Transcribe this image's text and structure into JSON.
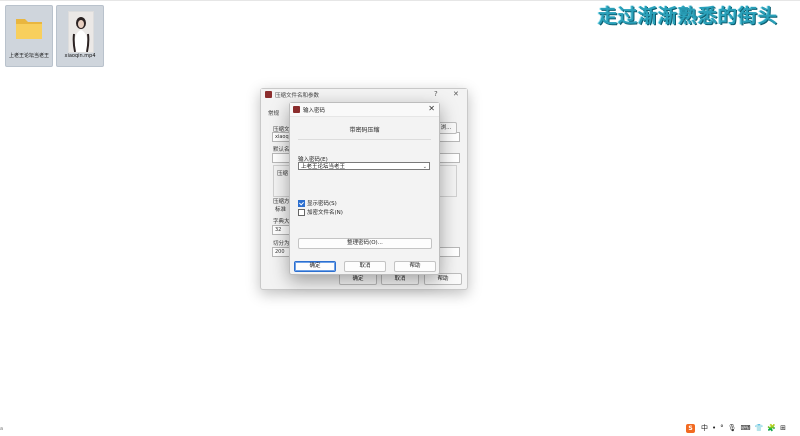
{
  "desktop": {
    "icons": [
      {
        "label": "上老王论坛当老王",
        "type": "folder"
      },
      {
        "label": "xiaoqin.mp4",
        "type": "video"
      }
    ]
  },
  "watermark": "走过渐渐熟悉的街头",
  "back_dialog": {
    "title": "压缩文件名和参数",
    "help_btn": "?",
    "close_btn": "✕",
    "tab": "常规",
    "archive_name_label": "压缩文",
    "archive_name_value": "xiaoqi",
    "browse_btn": "浏...",
    "default_label": "默认名",
    "format_group": "压缩",
    "method_label": "压缩方",
    "method_value": "标准",
    "dict_label": "字典大",
    "dict_value": "32",
    "split_label": "切分为",
    "split_value": "200",
    "ok": "确定",
    "cancel": "取消",
    "help": "帮助"
  },
  "front_dialog": {
    "title": "输入密码",
    "close_btn": "✕",
    "heading": "带密码压缩",
    "password_label": "输入密码(E)",
    "password_value": "上老王论坛当老王",
    "show_password": "显示密码(S)",
    "show_password_checked": true,
    "encrypt_names": "加密文件名(N)",
    "encrypt_names_checked": false,
    "organize_btn": "整理密码(O)...",
    "ok": "确定",
    "cancel": "取消",
    "help": "帮助"
  },
  "tray": {
    "ime_logo": "S",
    "ime_lang": "中",
    "items": [
      "•",
      "°",
      "🎙",
      "⌨",
      "👕",
      "🧩",
      "⊞"
    ]
  },
  "edge_text": "a"
}
